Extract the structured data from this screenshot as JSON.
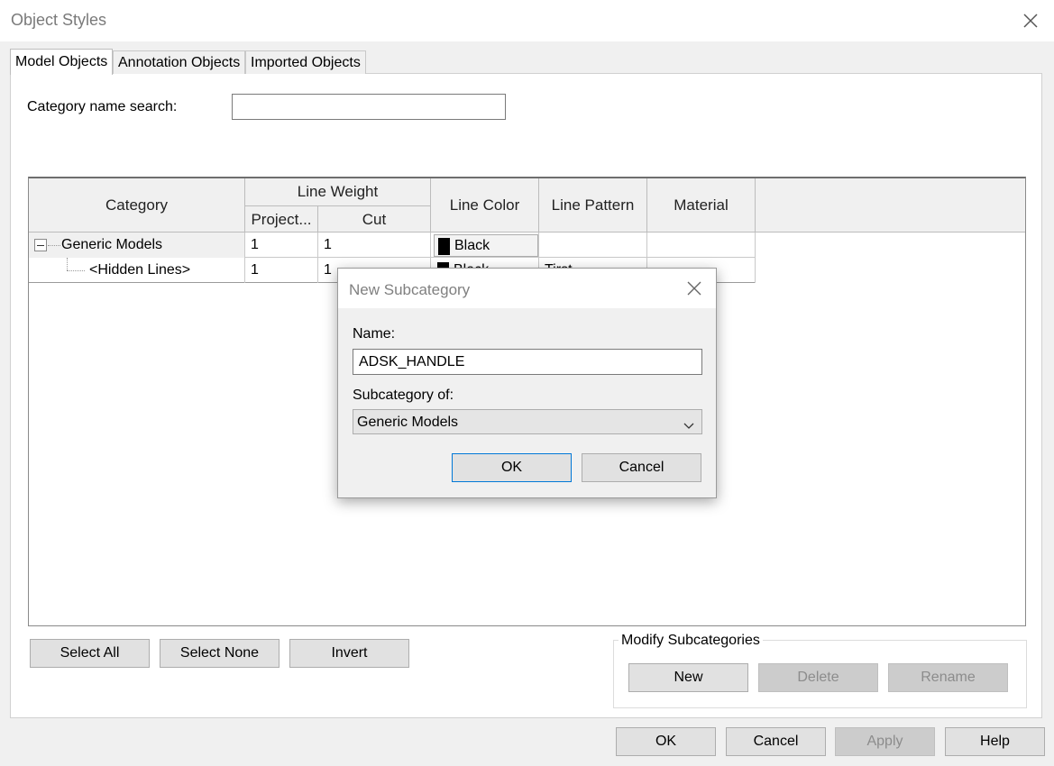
{
  "window": {
    "title": "Object Styles"
  },
  "tabs": [
    {
      "label": "Model Objects",
      "active": true
    },
    {
      "label": "Annotation Objects",
      "active": false
    },
    {
      "label": "Imported Objects",
      "active": false
    }
  ],
  "search": {
    "label": "Category name search:",
    "value": "",
    "placeholder": ""
  },
  "grid": {
    "headers": {
      "category": "Category",
      "line_weight": "Line Weight",
      "projection": "Project...",
      "cut": "Cut",
      "line_color": "Line Color",
      "line_pattern": "Line Pattern",
      "material": "Material"
    },
    "rows": [
      {
        "category": "Generic Models",
        "projection": "1",
        "cut": "1",
        "line_color": "Black",
        "line_pattern": "",
        "material": ""
      },
      {
        "category": "<Hidden Lines>",
        "projection": "1",
        "cut": "1",
        "line_color": "Black",
        "line_pattern": "Tirst",
        "material": ""
      }
    ]
  },
  "selection_buttons": {
    "select_all": "Select All",
    "select_none": "Select None",
    "invert": "Invert"
  },
  "modify_subcategories": {
    "legend": "Modify Subcategories",
    "new": "New",
    "delete": "Delete",
    "rename": "Rename"
  },
  "footer": {
    "ok": "OK",
    "cancel": "Cancel",
    "apply": "Apply",
    "help": "Help"
  },
  "modal": {
    "title": "New Subcategory",
    "name_label": "Name:",
    "name_value": "ADSK_HANDLE",
    "subcategory_label": "Subcategory of:",
    "subcategory_value": "Generic Models",
    "ok": "OK",
    "cancel": "Cancel"
  },
  "colors": {
    "swatch": "#000000",
    "focus_border": "#0078d7",
    "disabled_text": "#8c8c8c"
  }
}
